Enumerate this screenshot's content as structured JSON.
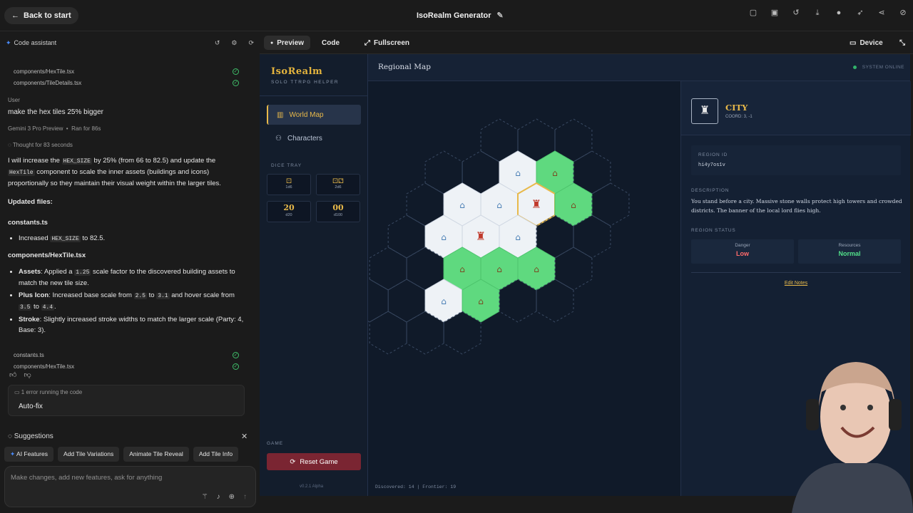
{
  "topbar": {
    "back_label": "Back to start",
    "app_title": "IsoRealm Generator",
    "icons": [
      "play-icon",
      "save-icon",
      "history-icon",
      "download-icon",
      "github-icon",
      "rocket-icon",
      "share-icon",
      "hide-icon"
    ]
  },
  "chat": {
    "header": "Code assistant",
    "files_before": [
      "components/HexTile.tsx",
      "components/TileDetails.tsx"
    ],
    "user_label": "User",
    "user_msg": "make the hex tiles 25% bigger",
    "model_info": "Gemini 3 Pro Preview",
    "run_info": "Ran for 86s",
    "thought": "Thought for 83 seconds",
    "intro_a": "I will increase the ",
    "intro_code1": "HEX_SIZE",
    "intro_b": " by 25% (from 66 to 82.5) and update the",
    "intro_code2": "HexTile",
    "intro_c": " component to scale the inner assets (buildings and icons)",
    "intro_d": "proportionally so they maintain their visual weight within the larger tiles.",
    "updated_files": "Updated files:",
    "file1": "constants.ts",
    "file1_bullet_a": "Increased ",
    "file1_bullet_code": "HEX_SIZE",
    "file1_bullet_b": " to 82.5.",
    "file2": "components/HexTile.tsx",
    "b1_label": "Assets",
    "b1_text_a": ": Applied a ",
    "b1_code": "1.25",
    "b1_text_b": " scale factor to the discovered building assets to match the new tile size.",
    "b2_label": "Plus Icon",
    "b2_text_a": ": Increased base scale from ",
    "b2_code1": "2.5",
    "b2_text_b": " to ",
    "b2_code2": "3.1",
    "b2_text_c": " and hover scale from ",
    "b2_code3": "3.5",
    "b2_text_d": " to ",
    "b2_code4": "4.4",
    "b2_text_e": ".",
    "b3_label": "Stroke",
    "b3_text": ": Slightly increased stroke widths to match the larger scale (Party: 4, Base: 3).",
    "files_after": [
      "constants.ts",
      "components/HexTile.tsx"
    ],
    "error_text": "1 error running the code",
    "autofix": "Auto-fix",
    "suggestions_title": "Suggestions",
    "chips": [
      "AI Features",
      "Add Tile Variations",
      "Animate Tile Reveal",
      "Add Tile Info"
    ],
    "prompt_placeholder": "Make changes, add new features, ask for anything"
  },
  "preview": {
    "tabs": [
      "Preview",
      "Code",
      "Fullscreen"
    ],
    "device": "Device"
  },
  "app": {
    "logo": "IsoRealm",
    "logo_sub": "SOLO TTRPG HELPER",
    "nav": [
      "World Map",
      "Characters"
    ],
    "dice_title": "DICE TRAY",
    "dice": [
      {
        "label": "1d6",
        "value": ""
      },
      {
        "label": "2d6",
        "value": ""
      },
      {
        "label": "d20",
        "value": "20"
      },
      {
        "label": "d100",
        "value": "00"
      }
    ],
    "game_title": "GAME",
    "reset": "Reset Game",
    "version": "v0.2.1 Alpha",
    "map_title": "Regional Map",
    "system_status": "SYSTEM ONLINE",
    "status_line": "Discovered: 14 | Frontier: 19",
    "detail": {
      "name": "CITY",
      "coord": "COORD: 3, -1",
      "region_id_label": "REGION ID",
      "region_id": "hi4y7os1v",
      "description_label": "DESCRIPTION",
      "description": "You stand before a city. Massive stone walls protect high towers and crowded districts. The banner of the local lord flies high.",
      "status_label": "REGION STATUS",
      "danger_label": "Danger",
      "danger_value": "Low",
      "resources_label": "Resources",
      "resources_value": "Normal",
      "edit_notes": "Edit Notes"
    },
    "colors": {
      "accent": "#e8b94a",
      "danger": "#ff6b6b",
      "resources": "#52e08a",
      "plains": "#5fd97f",
      "snow": "#f0f3f7"
    }
  }
}
